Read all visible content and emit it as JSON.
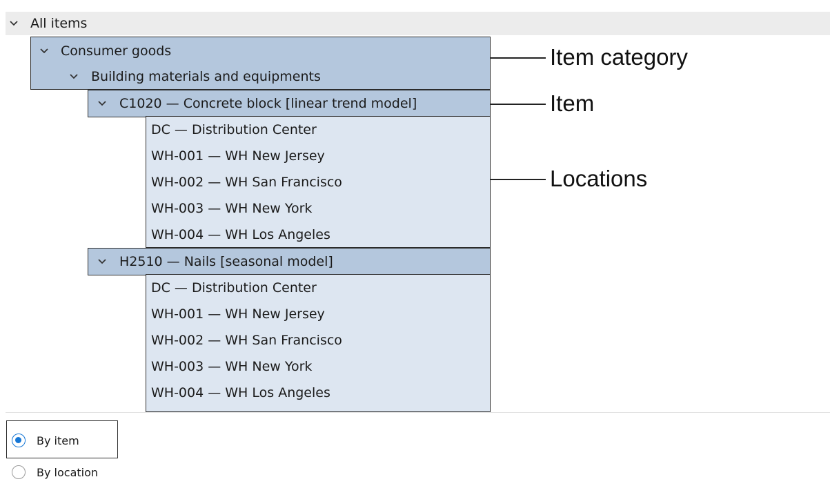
{
  "tree": {
    "root": {
      "label": "All items",
      "expanded": true
    },
    "category": {
      "label": "Consumer goods",
      "expanded": true
    },
    "subcategory": {
      "label": "Building materials and equipments",
      "expanded": true
    },
    "items": [
      {
        "label": "C1020 — Concrete block [linear trend model]",
        "expanded": true,
        "locations": [
          "DC — Distribution Center",
          "WH-001 — WH New Jersey",
          "WH-002 — WH San Francisco",
          "WH-003 — WH New York",
          "WH-004 — WH Los Angeles"
        ]
      },
      {
        "label": "H2510 — Nails [seasonal model]",
        "expanded": true,
        "locations": [
          "DC — Distribution Center",
          "WH-001 — WH New Jersey",
          "WH-002 — WH San Francisco",
          "WH-003 — WH New York",
          "WH-004 — WH Los Angeles"
        ]
      }
    ]
  },
  "callouts": {
    "item_category": "Item category",
    "item": "Item",
    "locations": "Locations"
  },
  "grouping": {
    "options": [
      {
        "label": "By item",
        "selected": true
      },
      {
        "label": "By location",
        "selected": false
      }
    ]
  },
  "colors": {
    "highlight_dark": "#b4c7dd",
    "highlight_light": "#dde6f1",
    "radio_accent": "#1677d6",
    "header_bg": "#ececec"
  },
  "icons": {
    "expand": "chevron-down-icon",
    "radio_selected": "radio-selected-icon",
    "radio_unselected": "radio-unselected-icon"
  }
}
